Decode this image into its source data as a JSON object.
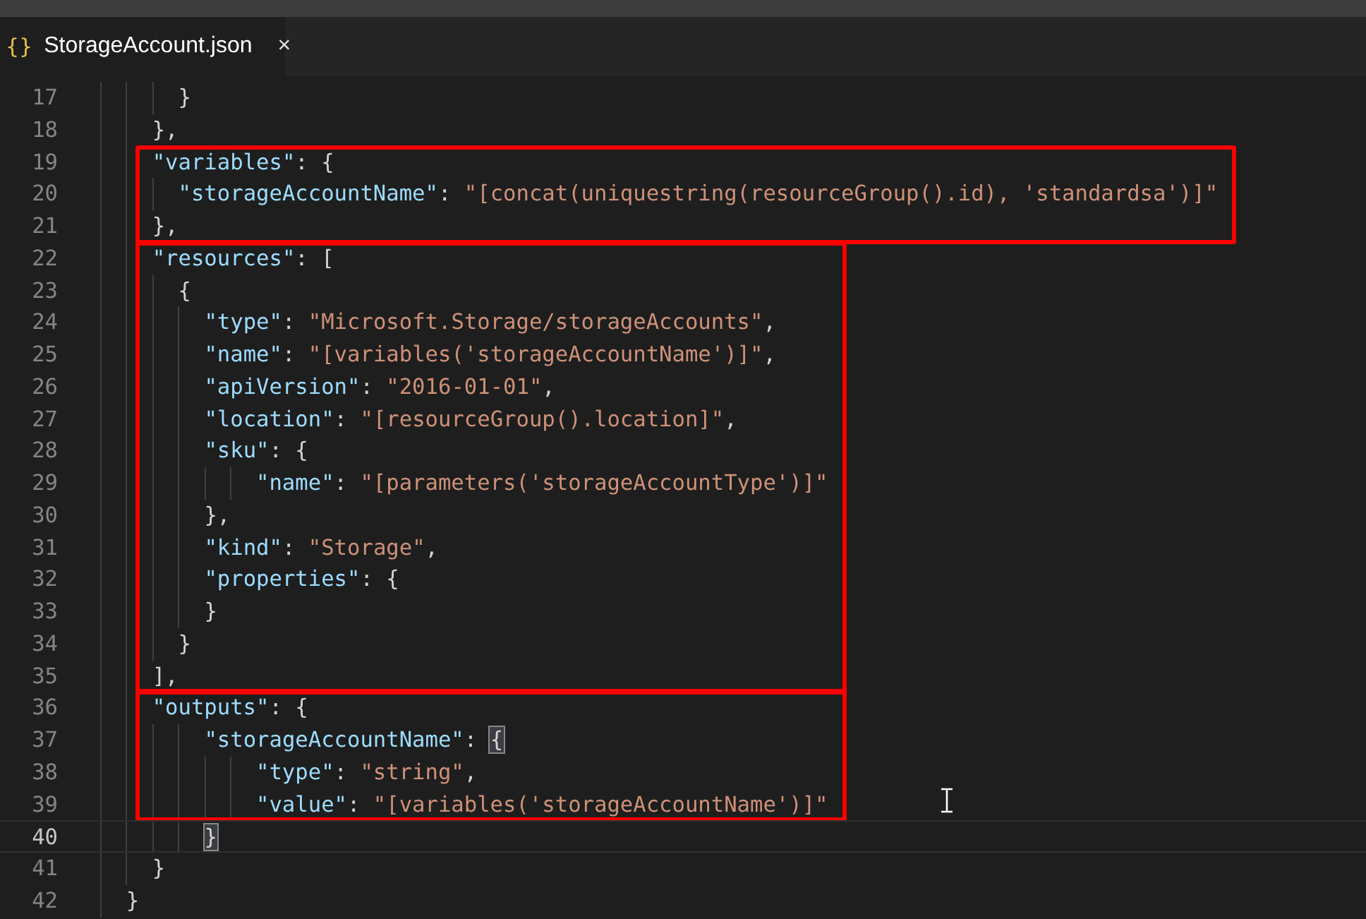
{
  "tab": {
    "icon": "{}",
    "label": "StorageAccount.json",
    "close": "×",
    "selected": true
  },
  "editor": {
    "blocks": [
      {
        "highlighted": false,
        "lines": [
          {
            "number": "17",
            "text": "      }",
            "current": false,
            "bracket_highlight": false
          },
          {
            "number": "18",
            "text": "    },",
            "current": false,
            "bracket_highlight": false
          }
        ]
      },
      {
        "highlighted": true,
        "lines": [
          {
            "number": "19",
            "text": "    \"variables\": {",
            "current": false,
            "bracket_highlight": false
          },
          {
            "number": "20",
            "text": "      \"storageAccountName\": \"[concat(uniquestring(resourceGroup().id), 'standardsa')]\"",
            "current": false,
            "bracket_highlight": false
          },
          {
            "number": "21",
            "text": "    },",
            "current": false,
            "bracket_highlight": false
          }
        ]
      },
      {
        "highlighted": true,
        "lines": [
          {
            "number": "22",
            "text": "    \"resources\": [",
            "current": false,
            "bracket_highlight": false
          },
          {
            "number": "23",
            "text": "      {",
            "current": false,
            "bracket_highlight": false
          },
          {
            "number": "24",
            "text": "        \"type\": \"Microsoft.Storage/storageAccounts\",",
            "current": false,
            "bracket_highlight": false
          },
          {
            "number": "25",
            "text": "        \"name\": \"[variables('storageAccountName')]\",",
            "current": false,
            "bracket_highlight": false
          },
          {
            "number": "26",
            "text": "        \"apiVersion\": \"2016-01-01\",",
            "current": false,
            "bracket_highlight": false
          },
          {
            "number": "27",
            "text": "        \"location\": \"[resourceGroup().location]\",",
            "current": false,
            "bracket_highlight": false
          },
          {
            "number": "28",
            "text": "        \"sku\": {",
            "current": false,
            "bracket_highlight": false
          },
          {
            "number": "29",
            "text": "            \"name\": \"[parameters('storageAccountType')]\"",
            "current": false,
            "bracket_highlight": false
          },
          {
            "number": "30",
            "text": "        },",
            "current": false,
            "bracket_highlight": false
          },
          {
            "number": "31",
            "text": "        \"kind\": \"Storage\",",
            "current": false,
            "bracket_highlight": false
          },
          {
            "number": "32",
            "text": "        \"properties\": {",
            "current": false,
            "bracket_highlight": false
          },
          {
            "number": "33",
            "text": "        }",
            "current": false,
            "bracket_highlight": false
          },
          {
            "number": "34",
            "text": "      }",
            "current": false,
            "bracket_highlight": false
          },
          {
            "number": "35",
            "text": "    ],",
            "current": false,
            "bracket_highlight": false
          }
        ]
      },
      {
        "highlighted": true,
        "lines": [
          {
            "number": "36",
            "text": "    \"outputs\": {",
            "current": false,
            "bracket_highlight": false
          },
          {
            "number": "37",
            "text": "        \"storageAccountName\": {",
            "current": false,
            "bracket_highlight": true
          },
          {
            "number": "38",
            "text": "            \"type\": \"string\",",
            "current": false,
            "bracket_highlight": false
          },
          {
            "number": "39",
            "text": "            \"value\": \"[variables('storageAccountName')]\"",
            "current": false,
            "bracket_highlight": false
          }
        ]
      },
      {
        "highlighted": false,
        "lines": [
          {
            "number": "40",
            "text": "        }",
            "current": true,
            "bracket_highlight": true
          },
          {
            "number": "41",
            "text": "    }",
            "current": false,
            "bracket_highlight": false
          },
          {
            "number": "42",
            "text": "  }",
            "current": false,
            "bracket_highlight": false
          }
        ]
      }
    ]
  }
}
